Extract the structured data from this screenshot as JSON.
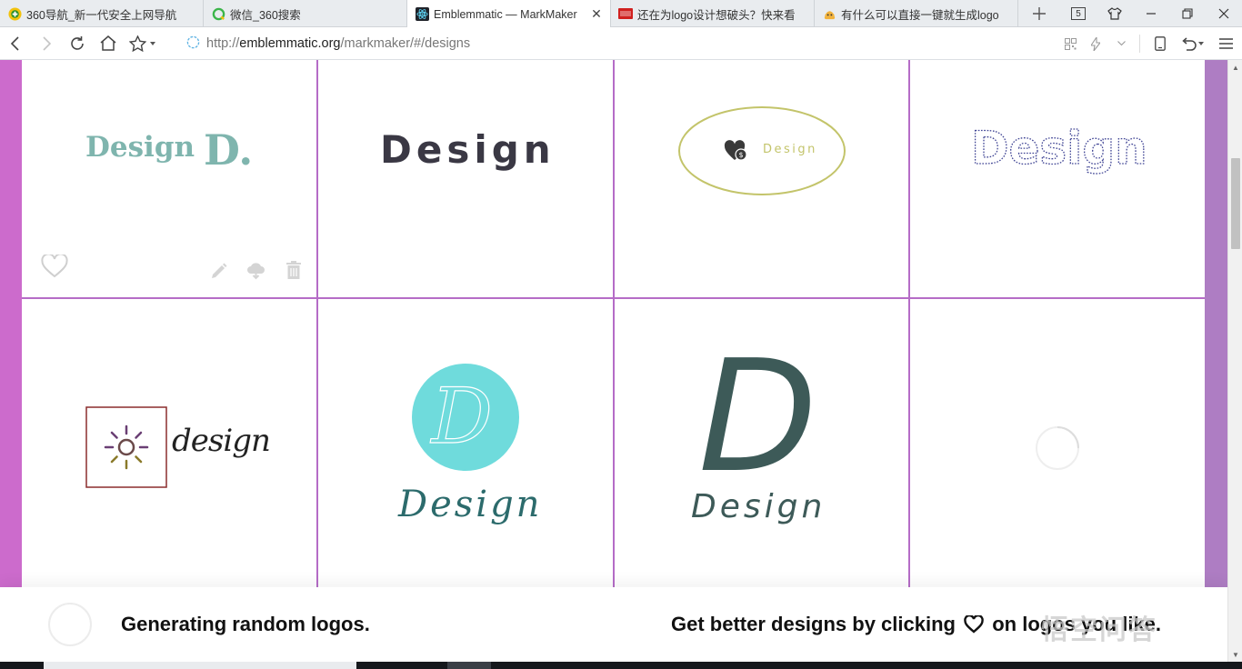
{
  "tabs": [
    {
      "title": "360导航_新一代安全上网导航",
      "active": false,
      "closable": false
    },
    {
      "title": "微信_360搜索",
      "active": false,
      "closable": false
    },
    {
      "title": "Emblemmatic — MarkMaker",
      "active": true,
      "closable": true
    },
    {
      "title": "还在为logo设计想破头？快来看",
      "active": false,
      "closable": false
    },
    {
      "title": "有什么可以直接一键就生成logo",
      "active": false,
      "closable": false
    }
  ],
  "tab_count": "5",
  "address": {
    "scheme": "http://",
    "host": "emblemmatic.org",
    "path": "/markmaker/#/designs"
  },
  "logos": [
    {
      "text": "Design",
      "mark": "D.",
      "color": "#7fb5ae"
    },
    {
      "text": "Design",
      "color": "#3a3844"
    },
    {
      "text": "Design",
      "color": "#c3c46a"
    },
    {
      "text": "Design",
      "color": "#3f4494"
    },
    {
      "text": "design",
      "color": "#222222"
    },
    {
      "text": "Design",
      "mark": "D",
      "color": "#2c6b6c"
    },
    {
      "text": "Design",
      "mark": "D",
      "color": "#3d5a58"
    },
    {
      "text": "",
      "loading": true
    }
  ],
  "banner": {
    "left_message": "Generating random logos.",
    "right_before": "Get better designs by clicking",
    "right_after": "on logos you like."
  },
  "watermark": "悟空问答",
  "colors": {
    "stripe_left": "#cc6bcc",
    "stripe_right": "#ae7dc3",
    "grid_lines": "#b56cc7",
    "turquoise_circle": "#6fdbdc",
    "frame_red": "#8b2d2d"
  }
}
